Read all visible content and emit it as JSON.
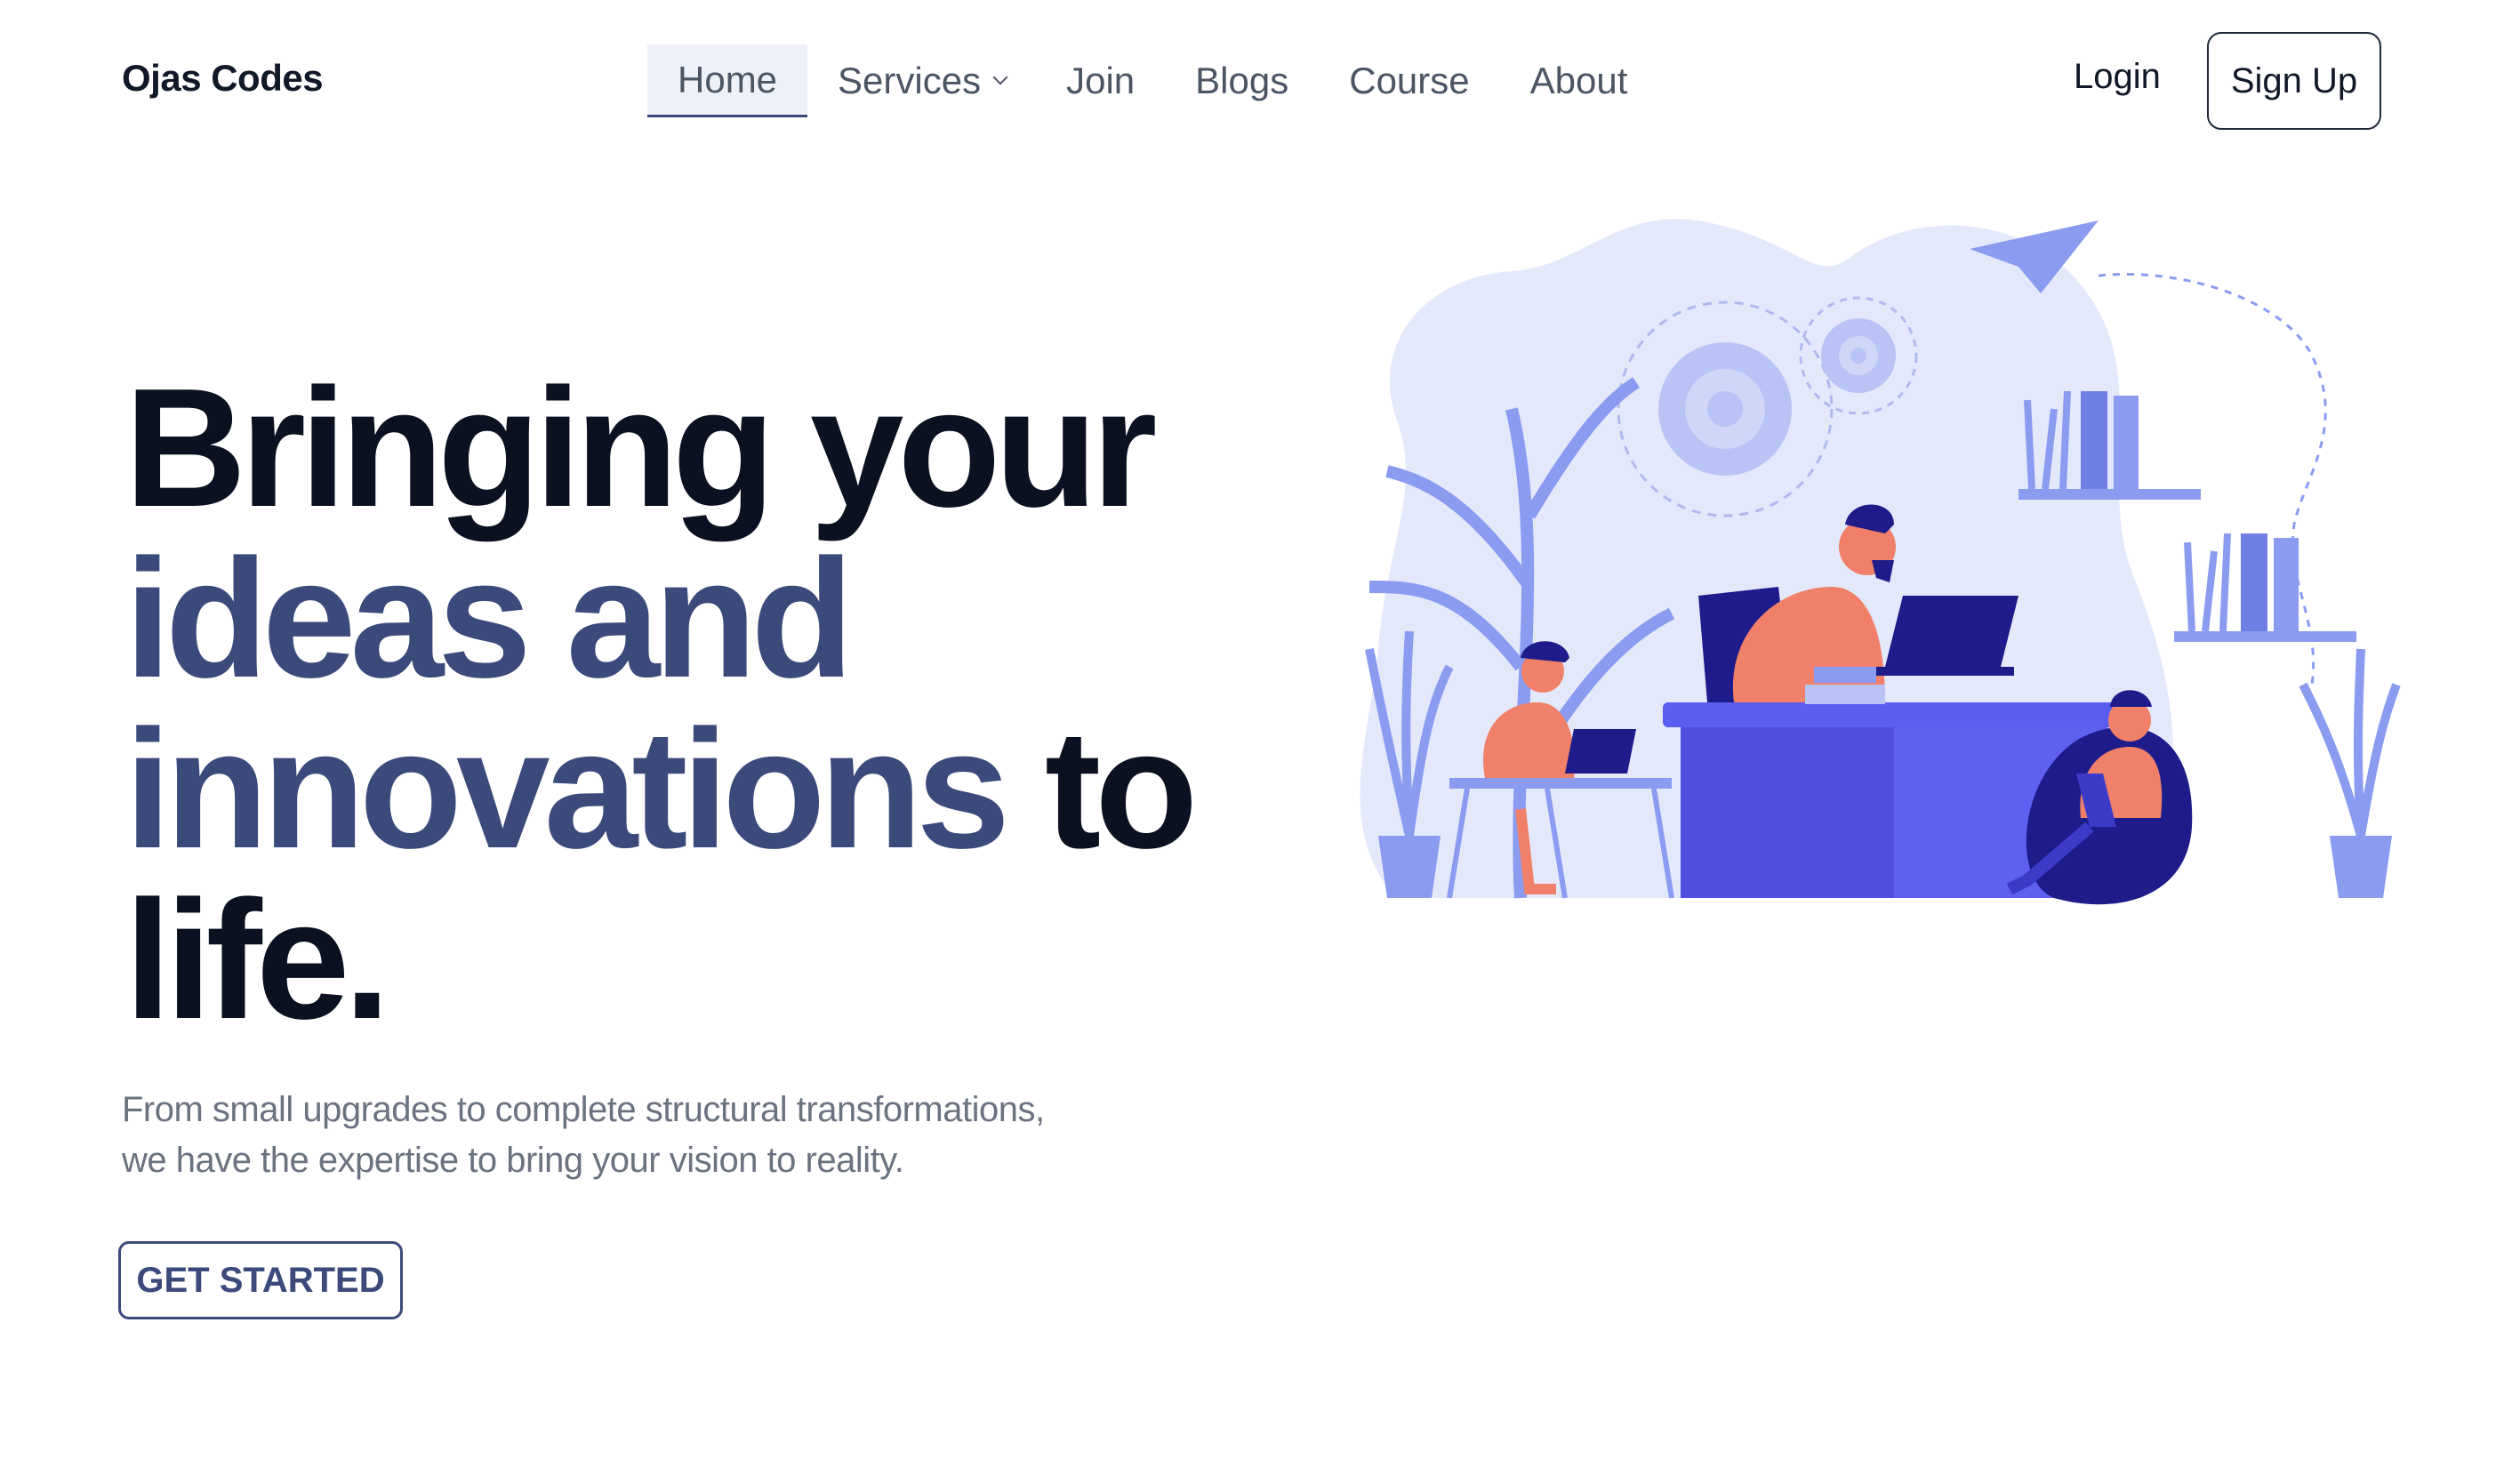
{
  "brand": {
    "name": "Ojas Codes"
  },
  "nav": {
    "items": [
      {
        "label": "Home",
        "active": true
      },
      {
        "label": "Services",
        "has_dropdown": true
      },
      {
        "label": "Join"
      },
      {
        "label": "Blogs"
      },
      {
        "label": "Course"
      },
      {
        "label": "About"
      }
    ]
  },
  "auth": {
    "login_label": "Login",
    "signup_label": "Sign Up"
  },
  "hero": {
    "title_part1": "Bringing your",
    "title_accent": "ideas and innovations",
    "title_part2": "to life.",
    "subtitle_line1": "From small upgrades to complete structural transformations,",
    "subtitle_line2": "we have the expertise to bring your vision to reality.",
    "cta_label": "GET STARTED"
  },
  "colors": {
    "accent": "#3b4a7a",
    "heading": "#0b1120",
    "illustration_primary": "#4f4ee0",
    "illustration_person": "#f0806a",
    "illustration_bg": "#e4e8fb"
  },
  "icons": {
    "dropdown": "chevron-down-icon",
    "illustration": "office-workers-illustration"
  }
}
